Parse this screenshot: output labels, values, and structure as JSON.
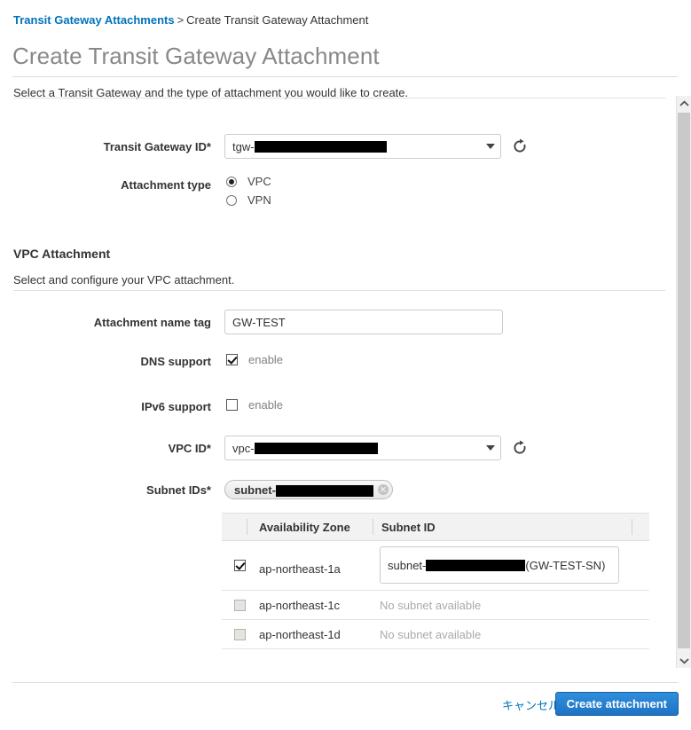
{
  "breadcrumb": {
    "parent": "Transit Gateway Attachments",
    "separator": ">",
    "current": "Create Transit Gateway Attachment"
  },
  "page": {
    "title": "Create Transit Gateway Attachment",
    "intro": "Select a Transit Gateway and the type of attachment you would like to create."
  },
  "transit_gateway": {
    "label": "Transit Gateway ID*",
    "value_prefix": "tgw-",
    "value_redacted": true,
    "refresh_icon": "refresh-icon",
    "dropdown_icon": "chevron-down-icon"
  },
  "attachment_type": {
    "label": "Attachment type",
    "options": [
      {
        "label": "VPC",
        "selected": true
      },
      {
        "label": "VPN",
        "selected": false
      }
    ]
  },
  "vpc_attachment": {
    "section_title": "VPC Attachment",
    "section_subtitle": "Select and configure your VPC attachment.",
    "name_tag": {
      "label": "Attachment name tag",
      "value": "GW-TEST"
    },
    "dns_support": {
      "label": "DNS support",
      "checkbox_label": "enable",
      "checked": true
    },
    "ipv6_support": {
      "label": "IPv6 support",
      "checkbox_label": "enable",
      "checked": false
    },
    "vpc_id": {
      "label": "VPC ID*",
      "value_prefix": "vpc-",
      "value_redacted": true,
      "refresh_icon": "refresh-icon",
      "dropdown_icon": "chevron-down-icon"
    },
    "subnet_ids": {
      "label": "Subnet IDs*",
      "chip_prefix": "subnet-",
      "chip_redacted": true,
      "chip_remove_icon": "close-icon"
    }
  },
  "subnet_table": {
    "columns": [
      "Availability Zone",
      "Subnet ID"
    ],
    "rows": [
      {
        "checked": true,
        "disabled": false,
        "availability_zone": "ap-northeast-1a",
        "subnet_prefix": "subnet-",
        "subnet_redacted": true,
        "subnet_suffix": "(GW-TEST-SN)",
        "has_dropdown": true,
        "empty_text": ""
      },
      {
        "checked": false,
        "disabled": true,
        "availability_zone": "ap-northeast-1c",
        "subnet_prefix": "",
        "subnet_redacted": false,
        "subnet_suffix": "",
        "has_dropdown": false,
        "empty_text": "No subnet available"
      },
      {
        "checked": false,
        "disabled": true,
        "availability_zone": "ap-northeast-1d",
        "subnet_prefix": "",
        "subnet_redacted": false,
        "subnet_suffix": "",
        "has_dropdown": false,
        "empty_text": "No subnet available"
      }
    ]
  },
  "footer": {
    "cancel_label": "キャンセル",
    "submit_label": "Create attachment"
  },
  "scrollbar": {
    "up_icon": "chevron-up-icon",
    "down_icon": "chevron-down-icon"
  },
  "colors": {
    "link": "#0073bb",
    "primary_button": "#1f72c4",
    "title_gray": "#888888",
    "muted": "#aaaaaa"
  }
}
